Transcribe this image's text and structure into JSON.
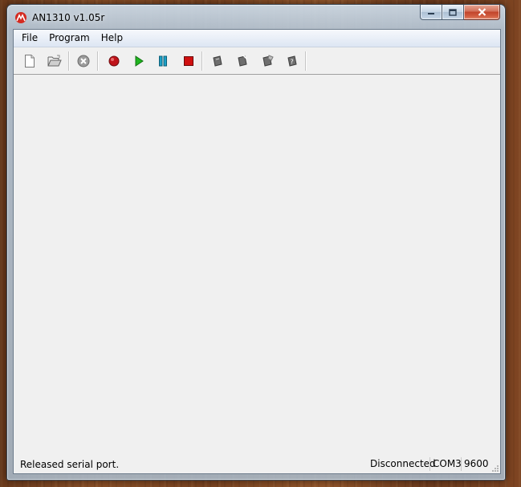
{
  "window": {
    "title": "AN1310 v1.05r",
    "app_icon": "microchip-logo-icon",
    "caption_buttons": [
      "minimize-icon",
      "maximize-icon",
      "close-icon"
    ]
  },
  "menu": {
    "items": [
      {
        "label": "File"
      },
      {
        "label": "Program"
      },
      {
        "label": "Help"
      }
    ]
  },
  "toolbar": {
    "buttons": [
      {
        "icon": "new-file-icon"
      },
      {
        "icon": "open-folder-icon"
      },
      {
        "icon": "abort-icon"
      },
      {
        "icon": "record-icon",
        "color": "#c0141a"
      },
      {
        "icon": "run-icon",
        "color": "#1fb51f"
      },
      {
        "icon": "pause-icon",
        "color": "#1aa0c8"
      },
      {
        "icon": "stop-icon",
        "color": "#d01010"
      },
      {
        "icon": "chip-write-icon"
      },
      {
        "icon": "chip-verify-icon"
      },
      {
        "icon": "chip-erase-icon"
      },
      {
        "icon": "chip-help-icon"
      }
    ]
  },
  "status": {
    "message": "Released serial port.",
    "connection": "Disconnected",
    "port": "COM3",
    "baud": "9600"
  }
}
